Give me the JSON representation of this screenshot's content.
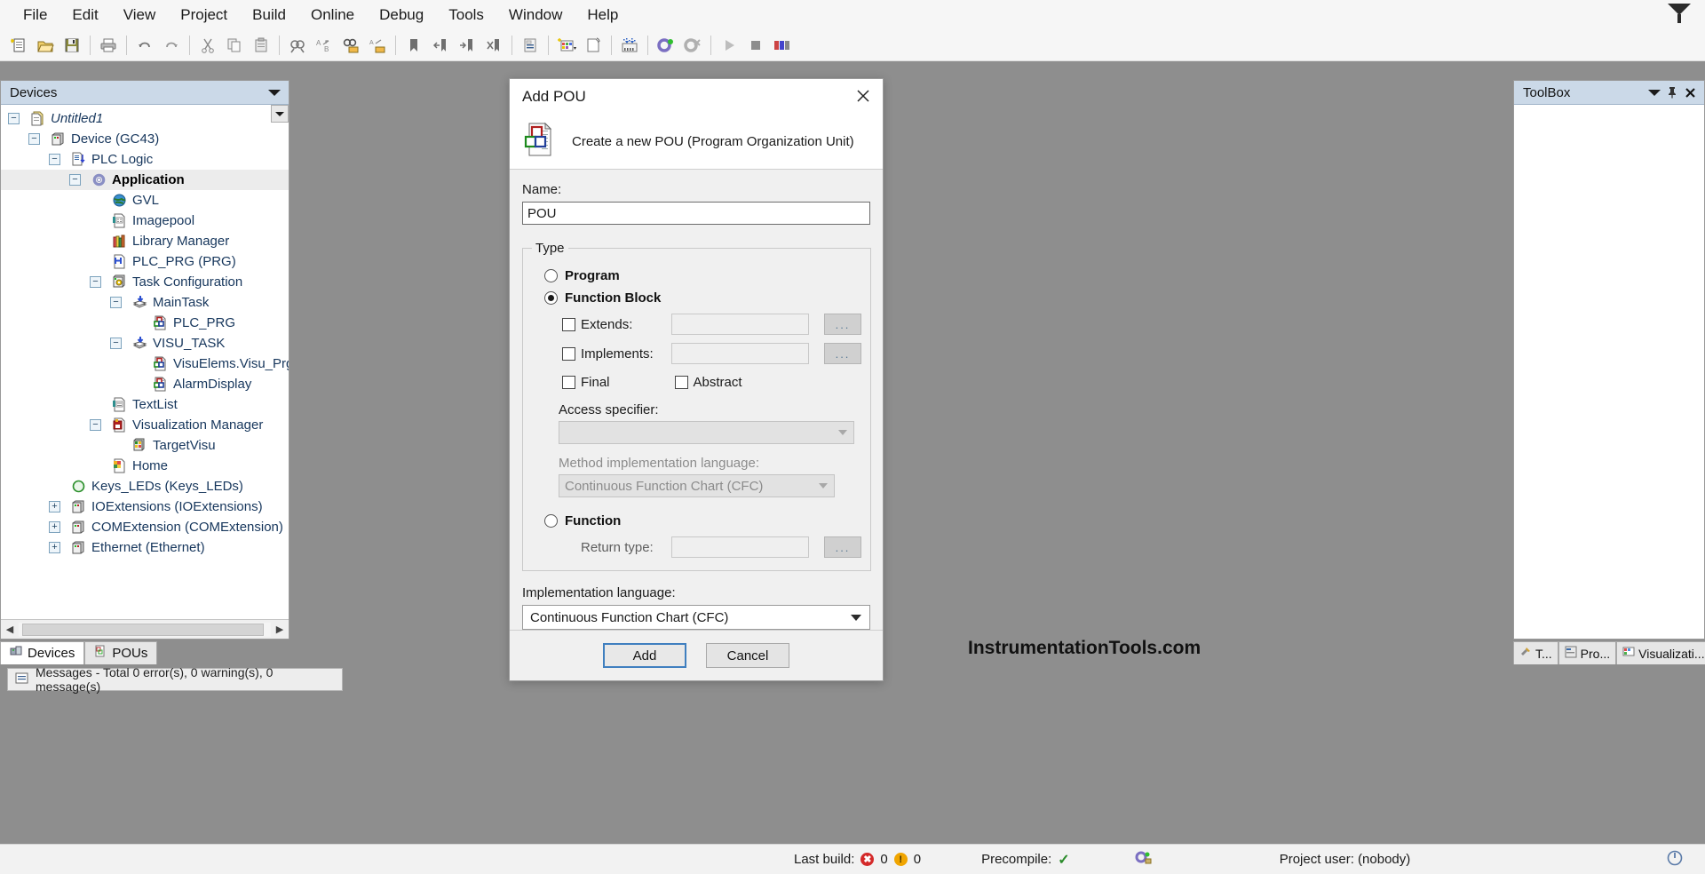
{
  "menubar": {
    "items": [
      {
        "label": "File"
      },
      {
        "label": "Edit"
      },
      {
        "label": "View"
      },
      {
        "label": "Project"
      },
      {
        "label": "Build"
      },
      {
        "label": "Online"
      },
      {
        "label": "Debug"
      },
      {
        "label": "Tools"
      },
      {
        "label": "Window"
      },
      {
        "label": "Help"
      }
    ],
    "right_icon": "filter-icon"
  },
  "toolbar": {
    "buttons": [
      {
        "name": "new-project-icon",
        "tip": "New Project"
      },
      {
        "name": "open-project-icon",
        "tip": "Open Project"
      },
      {
        "name": "save-project-icon",
        "tip": "Save Project"
      },
      {
        "name": "print-icon",
        "tip": "Print"
      },
      {
        "name": "undo-icon",
        "tip": "Undo"
      },
      {
        "name": "redo-icon",
        "tip": "Redo"
      },
      {
        "name": "cut-icon",
        "tip": "Cut"
      },
      {
        "name": "copy-icon",
        "tip": "Copy"
      },
      {
        "name": "paste-icon",
        "tip": "Paste"
      },
      {
        "name": "find-icon",
        "tip": "Find"
      },
      {
        "name": "replace-icon",
        "tip": "Replace"
      },
      {
        "name": "find-in-project-icon",
        "tip": "Find in Project"
      },
      {
        "name": "replace-in-project-icon",
        "tip": "Replace in Project"
      },
      {
        "name": "bookmark-icon",
        "tip": "Toggle Bookmark"
      },
      {
        "name": "previous-bookmark-icon",
        "tip": "Previous Bookmark"
      },
      {
        "name": "next-bookmark-icon",
        "tip": "Next Bookmark"
      },
      {
        "name": "clear-bookmarks-icon",
        "tip": "Clear Bookmarks"
      },
      {
        "name": "properties-icon",
        "tip": "Properties"
      },
      {
        "name": "new-visualization-icon",
        "tip": "New Visualization"
      },
      {
        "name": "new-object-icon",
        "tip": "New Object"
      },
      {
        "name": "build-icon",
        "tip": "Build"
      },
      {
        "name": "login-icon",
        "tip": "Login"
      },
      {
        "name": "logout-icon",
        "tip": "Logout"
      },
      {
        "name": "start-icon",
        "tip": "Start"
      },
      {
        "name": "stop-icon",
        "tip": "Stop"
      },
      {
        "name": "reset-icon",
        "tip": "Reset"
      }
    ]
  },
  "devices_panel": {
    "title": "Devices",
    "caret_icon": "chevron-down-icon",
    "pin_icon": "pin-icon",
    "close_icon": "close-icon",
    "tree": [
      {
        "label": "Untitled1",
        "depth": 0,
        "expander": "-",
        "icon": "project-icon",
        "style": "italic",
        "selected": false
      },
      {
        "label": "Device (GC43)",
        "depth": 1,
        "expander": "-",
        "icon": "device-icon",
        "style": "",
        "selected": false
      },
      {
        "label": "PLC Logic",
        "depth": 2,
        "expander": "-",
        "icon": "plclogic-icon",
        "style": "",
        "selected": false
      },
      {
        "label": "Application",
        "depth": 3,
        "expander": "-",
        "icon": "application-icon",
        "style": "bold",
        "selected": true
      },
      {
        "label": "GVL",
        "depth": 4,
        "expander": "",
        "icon": "gvl-icon",
        "style": "",
        "selected": false
      },
      {
        "label": "Imagepool",
        "depth": 4,
        "expander": "",
        "icon": "imagepool-icon",
        "style": "",
        "selected": false
      },
      {
        "label": "Library Manager",
        "depth": 4,
        "expander": "",
        "icon": "library-icon",
        "style": "",
        "selected": false
      },
      {
        "label": "PLC_PRG (PRG)",
        "depth": 4,
        "expander": "",
        "icon": "plcprg-icon",
        "style": "",
        "selected": false
      },
      {
        "label": "Task Configuration",
        "depth": 4,
        "expander": "-",
        "icon": "taskconfig-icon",
        "style": "",
        "selected": false
      },
      {
        "label": "MainTask",
        "depth": 5,
        "expander": "-",
        "icon": "task-icon",
        "style": "",
        "selected": false
      },
      {
        "label": "PLC_PRG",
        "depth": 6,
        "expander": "",
        "icon": "pou-icon",
        "style": "",
        "selected": false
      },
      {
        "label": "VISU_TASK",
        "depth": 5,
        "expander": "-",
        "icon": "task-icon",
        "style": "",
        "selected": false
      },
      {
        "label": "VisuElems.Visu_Prg",
        "depth": 6,
        "expander": "",
        "icon": "pou-icon",
        "style": "",
        "selected": false
      },
      {
        "label": "AlarmDisplay",
        "depth": 6,
        "expander": "",
        "icon": "pou-icon",
        "style": "",
        "selected": false
      },
      {
        "label": "TextList",
        "depth": 4,
        "expander": "",
        "icon": "textlist-icon",
        "style": "",
        "selected": false
      },
      {
        "label": "Visualization Manager",
        "depth": 4,
        "expander": "-",
        "icon": "visumanager-icon",
        "style": "",
        "selected": false
      },
      {
        "label": "TargetVisu",
        "depth": 5,
        "expander": "",
        "icon": "targetvisu-icon",
        "style": "",
        "selected": false
      },
      {
        "label": "Home",
        "depth": 4,
        "expander": "",
        "icon": "visu-icon",
        "style": "",
        "selected": false
      },
      {
        "label": "Keys_LEDs (Keys_LEDs)",
        "depth": 2,
        "expander": "",
        "icon": "keysleds-icon",
        "style": "",
        "selected": false
      },
      {
        "label": "IOExtensions (IOExtensions)",
        "depth": 2,
        "expander": "+",
        "icon": "device-icon",
        "style": "",
        "selected": false
      },
      {
        "label": "COMExtension (COMExtension)",
        "depth": 2,
        "expander": "+",
        "icon": "device-icon",
        "style": "",
        "selected": false
      },
      {
        "label": "Ethernet (Ethernet)",
        "depth": 2,
        "expander": "+",
        "icon": "device-icon",
        "style": "",
        "selected": false
      }
    ],
    "tabs": [
      {
        "label": "Devices",
        "icon": "devices-tab-icon",
        "active": true
      },
      {
        "label": "POUs",
        "icon": "pous-tab-icon",
        "active": false
      }
    ]
  },
  "messages": {
    "icon": "messages-icon",
    "text": "Messages - Total 0 error(s), 0 warning(s), 0 message(s)"
  },
  "toolbox_panel": {
    "title": "ToolBox",
    "caret_icon": "chevron-down-icon",
    "pin_icon": "pin-icon",
    "close_icon": "close-icon",
    "tabs": [
      {
        "label": "T...",
        "icon": "toolbox-tab-icon"
      },
      {
        "label": "Pro...",
        "icon": "properties-tab-icon"
      },
      {
        "label": "Visualizati...",
        "icon": "visualization-tab-icon"
      }
    ]
  },
  "watermark": "InstrumentationTools.com",
  "statusbar": {
    "last_build_label": "Last build:",
    "errors": "0",
    "warnings": "0",
    "precompile_label": "Precompile:",
    "precompile_state": "✓",
    "project_user_label": "Project user: (nobody)"
  },
  "dialog": {
    "title": "Add POU",
    "close_icon": "close-icon",
    "header_icon": "pou-large-icon",
    "header_text": "Create a new POU (Program Organization Unit)",
    "name_label": "Name:",
    "name_value": "POU",
    "name_placeholder": "POU",
    "type_group_label": "Type",
    "program": {
      "label": "Program",
      "selected": false
    },
    "function_block": {
      "label": "Function Block",
      "selected": true,
      "extends": {
        "label": "Extends:",
        "checked": false,
        "value": "",
        "browse_label": "..."
      },
      "implements": {
        "label": "Implements:",
        "checked": false,
        "value": "",
        "browse_label": "..."
      },
      "final": {
        "label": "Final",
        "checked": false
      },
      "abstract": {
        "label": "Abstract",
        "checked": false
      },
      "access_specifier": {
        "label": "Access specifier:",
        "value": "",
        "disabled": true
      },
      "method_language": {
        "label": "Method implementation language:",
        "value": "Continuous Function Chart (CFC)",
        "disabled": true
      }
    },
    "function": {
      "label": "Function",
      "selected": false,
      "return_type": {
        "label": "Return type:",
        "value": "",
        "browse_label": "..."
      }
    },
    "implementation_language": {
      "label": "Implementation language:",
      "value": "Continuous Function Chart (CFC)"
    },
    "add_button": "Add",
    "cancel_button": "Cancel"
  }
}
